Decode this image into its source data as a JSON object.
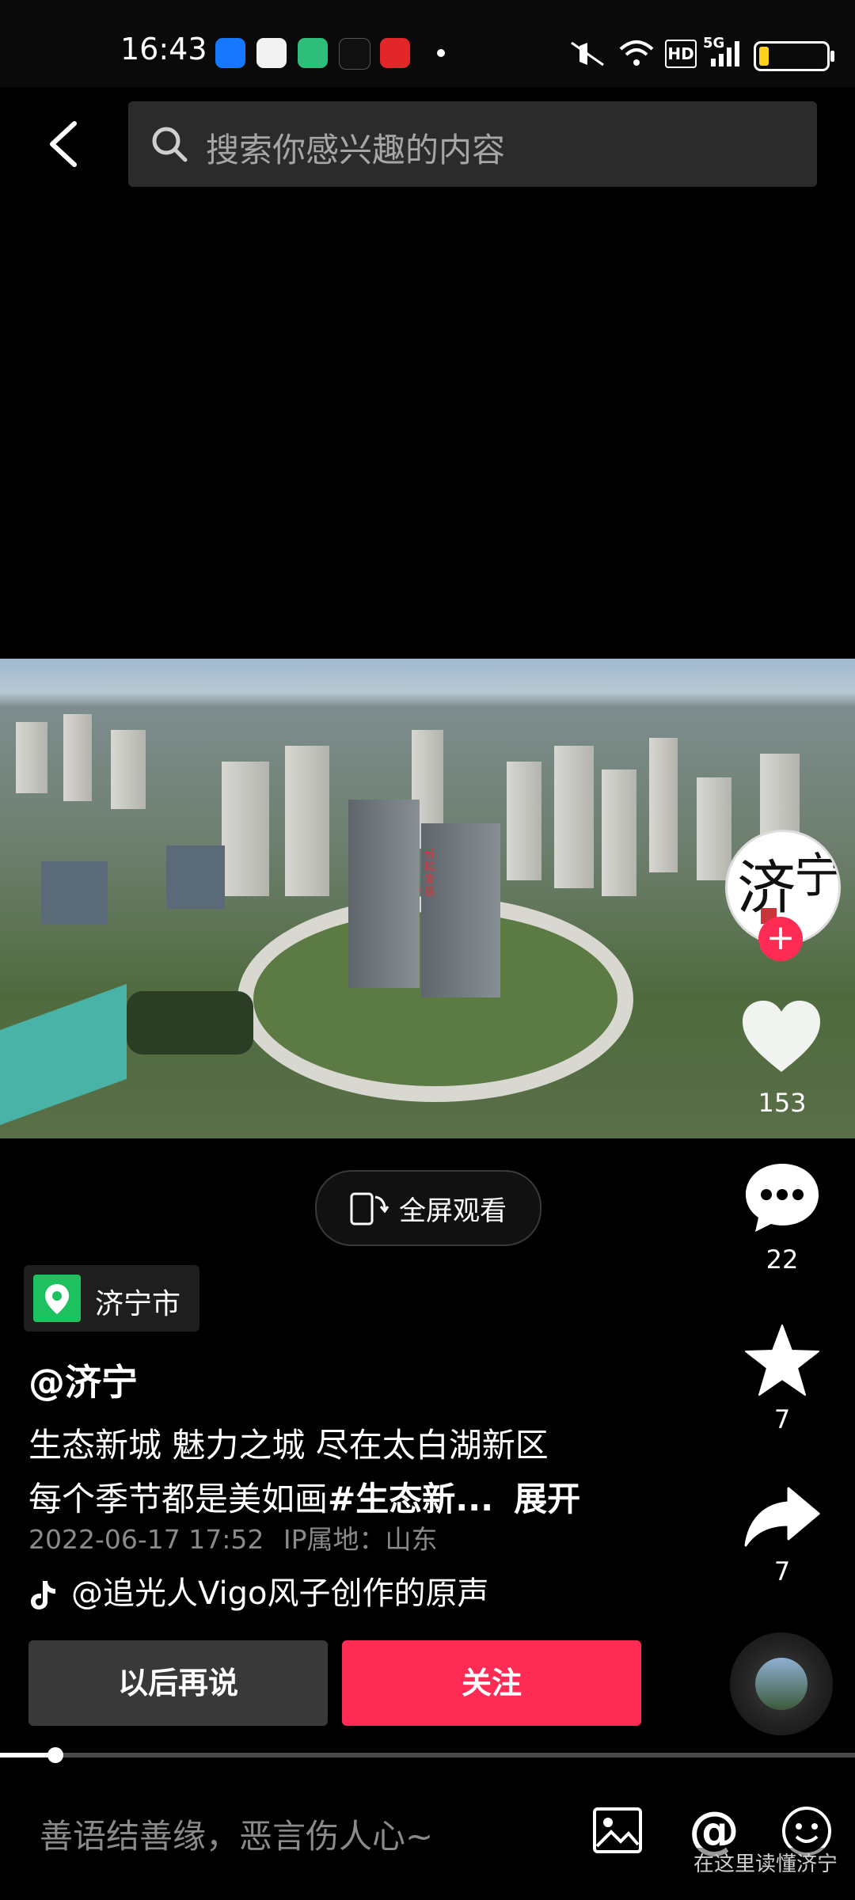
{
  "status_bar": {
    "time": "16:43",
    "app_icons": [
      "alipay-icon",
      "wallet-icon",
      "app-icon",
      "douyin-icon",
      "payment-app-icon"
    ],
    "indicators": [
      "mute-icon",
      "wifi-icon",
      "hd-icon",
      "5g-signal-icon",
      "battery-icon"
    ],
    "hd_label": "HD",
    "network_label": "5G"
  },
  "search": {
    "placeholder": "搜索你感兴趣的内容"
  },
  "video": {
    "building_sign": "新城发展",
    "progress": 0.065
  },
  "actions": {
    "likes": "153",
    "comments": "22",
    "favorites": "7",
    "shares": "7"
  },
  "fullscreen": {
    "label": "全屏观看"
  },
  "location": {
    "label": "济宁市"
  },
  "post": {
    "author": "@济宁",
    "caption_line1": "生态新城 魅力之城 尽在太白湖新区",
    "caption_line2_start": "每个季节都是美如画",
    "caption_hashtag": "#生态新...",
    "expand_label": "展开",
    "timestamp": "2022-06-17 17:52",
    "ip_location": "IP属地：山东",
    "music": "@追光人Vigo风子创作的原声"
  },
  "buttons": {
    "later": "以后再说",
    "follow": "关注"
  },
  "comment_bar": {
    "placeholder": "善语结善缘，恶言伤人心~",
    "watermark": "在这里读懂济宁"
  },
  "colors": {
    "accent": "#fe2c55",
    "location_green": "#1ec15f"
  }
}
